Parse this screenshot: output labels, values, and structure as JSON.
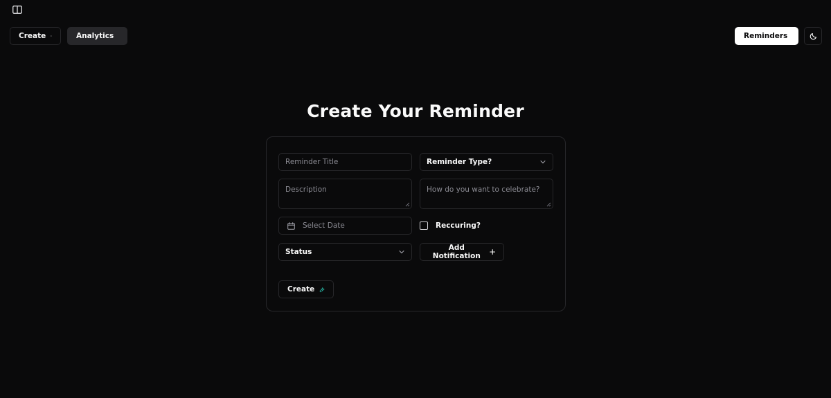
{
  "topbar": {
    "create_label": "Create",
    "analytics_label": "Analytics",
    "reminders_label": "Reminders"
  },
  "page": {
    "title": "Create Your Reminder"
  },
  "form": {
    "title_placeholder": "Reminder Title",
    "type_select_value": "Reminder Type?",
    "description_placeholder": "Description",
    "celebrate_placeholder": "How do you want to celebrate?",
    "date_placeholder": "Select Date",
    "recurring_label": "Reccuring?",
    "recurring_checked": false,
    "status_select_value": "Status",
    "add_notification_label": "Add Notification",
    "submit_label": "Create"
  },
  "icons": {
    "sidebar_toggle": "panel-left-icon",
    "create": "plus-icon",
    "analytics": "chart-line-icon",
    "reminders": "bell-icon",
    "theme": "moon-icon",
    "date": "calendar-icon",
    "select": "chevron-down-icon",
    "add_notification": "plus-icon",
    "submit": "sparkle-icon"
  },
  "colors": {
    "background": "#0a0a0b",
    "border": "#27272a",
    "accent": "#2dd4bf",
    "primary_button_bg": "#ffffff"
  }
}
